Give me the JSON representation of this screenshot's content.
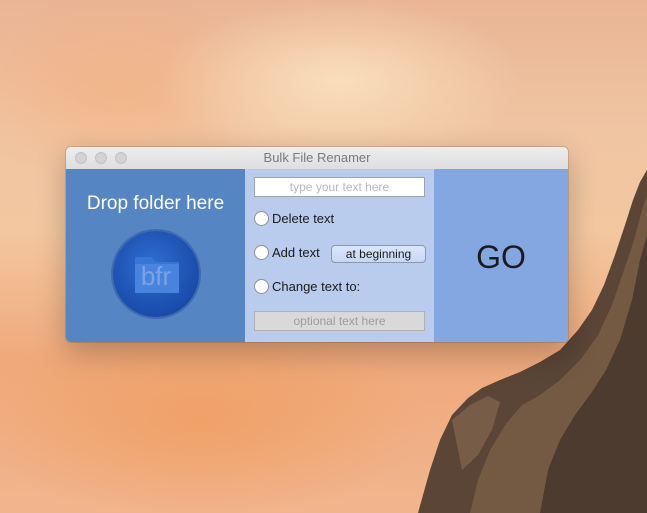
{
  "window": {
    "title": "Bulk File Renamer"
  },
  "drop_zone": {
    "label": "Drop folder here",
    "logo_text": "bfr"
  },
  "options": {
    "search_placeholder": "type your text here",
    "delete_label": "Delete text",
    "add_label": "Add text",
    "add_position": "at beginning",
    "change_label": "Change text to:",
    "replacement_placeholder": "optional text here"
  },
  "go_button": {
    "label": "GO"
  },
  "colors": {
    "drop_pane": "#5585c2",
    "options_pane": "#b9cced",
    "go_pane": "#85a7e1",
    "logo": "#1f56b8"
  }
}
